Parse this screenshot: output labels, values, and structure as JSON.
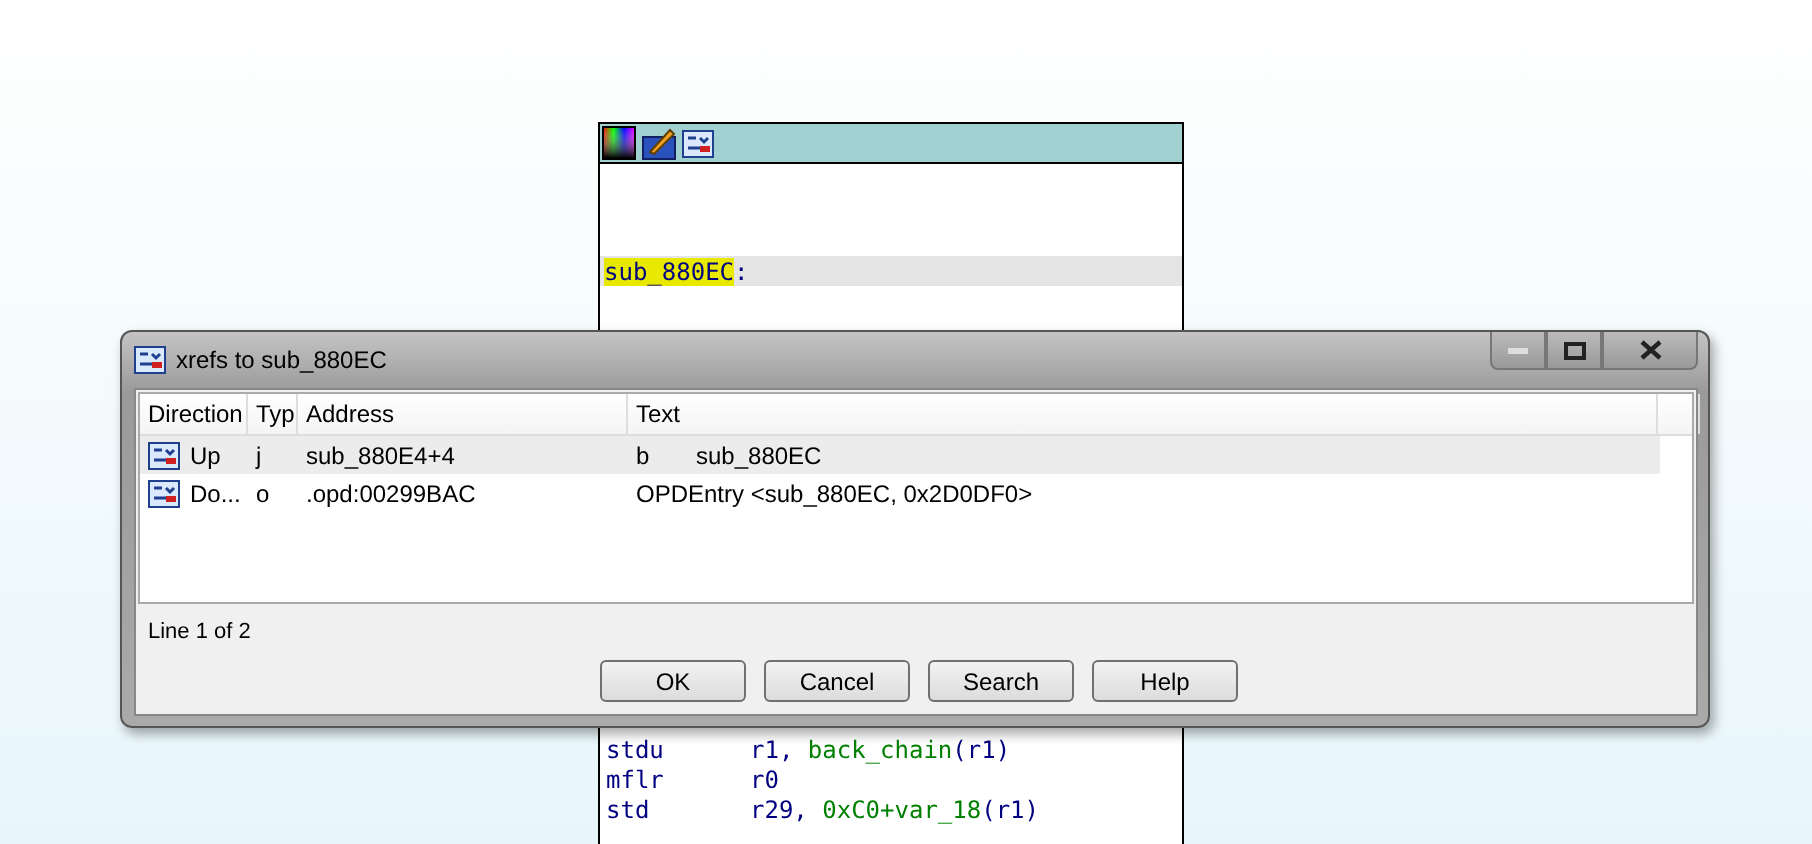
{
  "graph_node": {
    "label": "sub_880EC",
    "label_suffix": ":",
    "lines": [
      {
        "mnemonic": "stdu",
        "operands": [
          {
            "text": "r1, ",
            "kind": "reg"
          },
          {
            "text": "back_chain",
            "kind": "sym"
          },
          {
            "text": "(r1)",
            "kind": "reg"
          }
        ]
      },
      {
        "mnemonic": "mflr",
        "operands": [
          {
            "text": "r0",
            "kind": "reg"
          }
        ]
      },
      {
        "mnemonic": "std",
        "operands": [
          {
            "text": "r29, ",
            "kind": "reg"
          },
          {
            "text": "0xC0+var_18",
            "kind": "sym"
          },
          {
            "text": "(r1)",
            "kind": "reg"
          }
        ]
      }
    ]
  },
  "dialog": {
    "title": "xrefs to sub_880EC",
    "columns": [
      "Direction",
      "Typ",
      "Address",
      "Text"
    ],
    "rows": [
      {
        "direction": "Up",
        "type": "j",
        "address": "sub_880E4+4",
        "text": "b       sub_880EC",
        "selected": true
      },
      {
        "direction": "Do...",
        "type": "o",
        "address": ".opd:00299BAC",
        "text": "OPDEntry <sub_880EC, 0x2D0DF0>",
        "selected": false
      }
    ],
    "status": "Line 1 of 2",
    "buttons": [
      "OK",
      "Cancel",
      "Search",
      "Help"
    ]
  }
}
